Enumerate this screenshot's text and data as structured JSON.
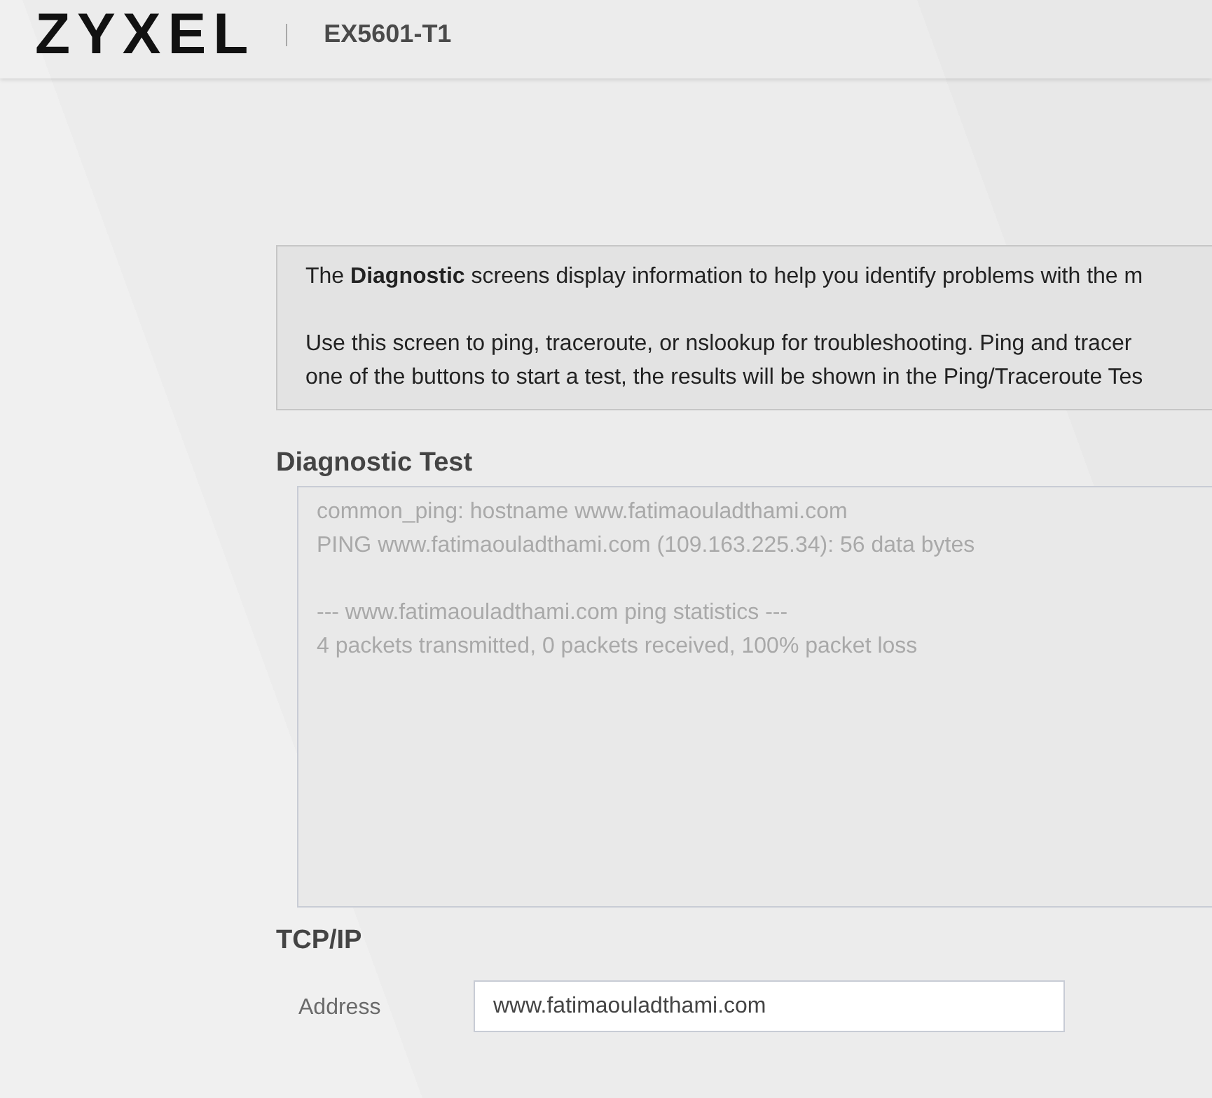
{
  "header": {
    "logo": "ZYXEL",
    "model": "EX5601-T1"
  },
  "intro": {
    "paragraphs": [
      [
        "The **Diagnostic** screens display information to help you identify problems with the m"
      ],
      [
        "Use this screen to ping, traceroute, or nslookup for troubleshooting. Ping and tracer",
        "one of the buttons to start a test, the results will be shown in the Ping/Traceroute Tes"
      ]
    ]
  },
  "diagnostic_test": {
    "title": "Diagnostic Test",
    "output_blocks": [
      [
        "common_ping: hostname www.fatimaouladthami.com",
        "PING www.fatimaouladthami.com (109.163.225.34): 56 data bytes"
      ],
      [
        "--- www.fatimaouladthami.com ping statistics ---",
        "4 packets transmitted, 0 packets received, 100% packet loss"
      ]
    ]
  },
  "tcp_ip": {
    "title": "TCP/IP",
    "fields": [
      {
        "label": "Address",
        "value": "www.fatimaouladthami.com"
      }
    ]
  }
}
